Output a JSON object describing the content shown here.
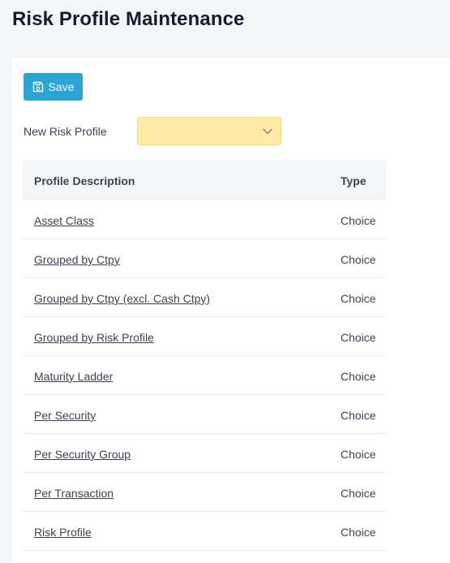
{
  "page": {
    "title": "Risk Profile Maintenance"
  },
  "toolbar": {
    "save_label": "Save"
  },
  "form": {
    "new_profile_label": "New Risk Profile",
    "new_profile_value": ""
  },
  "table": {
    "headers": {
      "description": "Profile Description",
      "type": "Type"
    },
    "rows": [
      {
        "description": "Asset Class",
        "type": "Choice"
      },
      {
        "description": "Grouped by Ctpy",
        "type": "Choice"
      },
      {
        "description": "Grouped by Ctpy (excl. Cash Ctpy)",
        "type": "Choice"
      },
      {
        "description": "Grouped by Risk Profile",
        "type": "Choice"
      },
      {
        "description": "Maturity Ladder",
        "type": "Choice"
      },
      {
        "description": "Per Security",
        "type": "Choice"
      },
      {
        "description": "Per Security Group",
        "type": "Choice"
      },
      {
        "description": "Per Transaction",
        "type": "Choice"
      },
      {
        "description": "Risk Profile",
        "type": "Choice"
      }
    ]
  },
  "colors": {
    "accent": "#2aa5d6",
    "select_bg": "#ffeba5",
    "page_bg": "#f3f6f9"
  },
  "icons": {
    "save": "floppy-disk-icon",
    "dropdown": "chevron-down-icon"
  }
}
